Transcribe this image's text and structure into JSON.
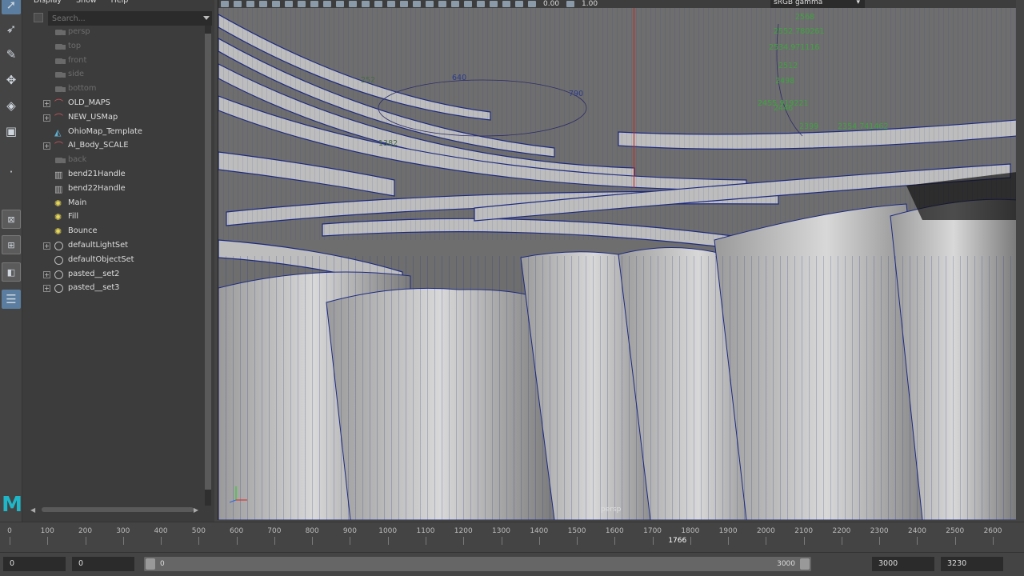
{
  "menu": [
    "Display",
    "Show",
    "Help"
  ],
  "search": {
    "placeholder": "Search..."
  },
  "outliner": {
    "items": [
      {
        "label": "persp",
        "icon": "camera-icon",
        "dim": true,
        "expand": false
      },
      {
        "label": "top",
        "icon": "camera-icon",
        "dim": true,
        "expand": false
      },
      {
        "label": "front",
        "icon": "camera-icon",
        "dim": true,
        "expand": false
      },
      {
        "label": "side",
        "icon": "camera-icon",
        "dim": true,
        "expand": false
      },
      {
        "label": "bottom",
        "icon": "camera-icon",
        "dim": true,
        "expand": false
      },
      {
        "label": "OLD_MAPS",
        "icon": "curve-group-icon",
        "dim": false,
        "expand": true
      },
      {
        "label": "NEW_USMap",
        "icon": "curve-group-icon",
        "dim": false,
        "expand": true
      },
      {
        "label": "OhioMap_Template",
        "icon": "template-icon",
        "dim": false,
        "expand": false
      },
      {
        "label": "AI_Body_SCALE",
        "icon": "curve-group-icon",
        "dim": false,
        "expand": true
      },
      {
        "label": "back",
        "icon": "camera-icon",
        "dim": true,
        "expand": false
      },
      {
        "label": "bend21Handle",
        "icon": "deformer-handle-icon",
        "dim": false,
        "expand": false
      },
      {
        "label": "bend22Handle",
        "icon": "deformer-handle-icon",
        "dim": false,
        "expand": false
      },
      {
        "label": "Main",
        "icon": "light-icon",
        "dim": false,
        "expand": false
      },
      {
        "label": "Fill",
        "icon": "light-icon",
        "dim": false,
        "expand": false
      },
      {
        "label": "Bounce",
        "icon": "light-icon",
        "dim": false,
        "expand": false
      },
      {
        "label": "defaultLightSet",
        "icon": "set-icon",
        "dim": false,
        "expand": true
      },
      {
        "label": "defaultObjectSet",
        "icon": "set-icon",
        "dim": false,
        "expand": false
      },
      {
        "label": "pasted__set2",
        "icon": "set-icon",
        "dim": false,
        "expand": true
      },
      {
        "label": "pasted__set3",
        "icon": "set-icon",
        "dim": false,
        "expand": true
      }
    ]
  },
  "viewport": {
    "camera": "persp",
    "exposure": "0.00",
    "gamma": "1.00",
    "color_space": "sRGB gamma",
    "annotations": [
      "2568",
      "2552.780261",
      "2534.971116",
      "2512",
      "2498",
      "2455.919221",
      "2446",
      "2399",
      "2354.741462",
      "640",
      "790",
      "252",
      "1382"
    ]
  },
  "timeline": {
    "ticks": [
      "0",
      "100",
      "200",
      "300",
      "400",
      "500",
      "600",
      "700",
      "800",
      "900",
      "1000",
      "1100",
      "1200",
      "1300",
      "1400",
      "1500",
      "1600",
      "1700",
      "1800",
      "1900",
      "2000",
      "2100",
      "2200",
      "2300",
      "2400",
      "2500",
      "2600"
    ],
    "current_frame": "1766"
  },
  "range": {
    "start": "0",
    "anim_start": "0",
    "slider_start": "0",
    "slider_end": "3000",
    "playback_end": "3000",
    "anim_end": "3230"
  }
}
